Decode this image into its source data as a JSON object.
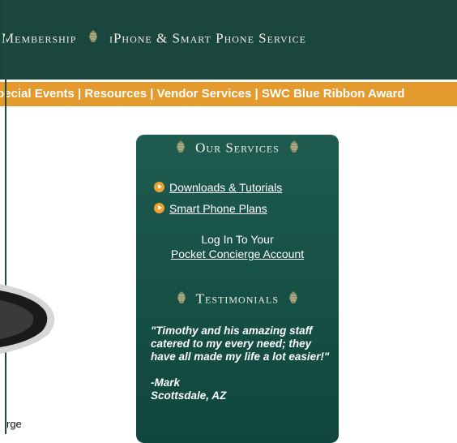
{
  "header": {
    "nav_items": [
      "Membership",
      "iPhone & Smart Phone Service"
    ]
  },
  "subnav": {
    "text": "pecial Events | Resources | Vendor Services | SWC Blue Ribbon Award"
  },
  "left": {
    "caption": "rge"
  },
  "services_panel": {
    "title": "Our Services",
    "links": [
      "Downloads & Tutorials",
      "Smart Phone Plans"
    ],
    "login_text": "Log In To Your",
    "login_link": "Pocket Concierge Account",
    "testimonials_title": "Testimonials",
    "testimonial_quote": "\"Timothy and his amazing staff catered to my every need; they have all made my life a lot easier!\"",
    "testimonial_author": "-Mark",
    "testimonial_location": "Scottsdale, AZ"
  },
  "colors": {
    "header_bg": "#1b463d",
    "subnav_bg": "#e49a2d",
    "panel_bg": "#1f5b4f",
    "bullet": "#f0a02e"
  },
  "icons": [
    "pinecone-icon",
    "play-bullet-icon",
    "phone-image"
  ]
}
